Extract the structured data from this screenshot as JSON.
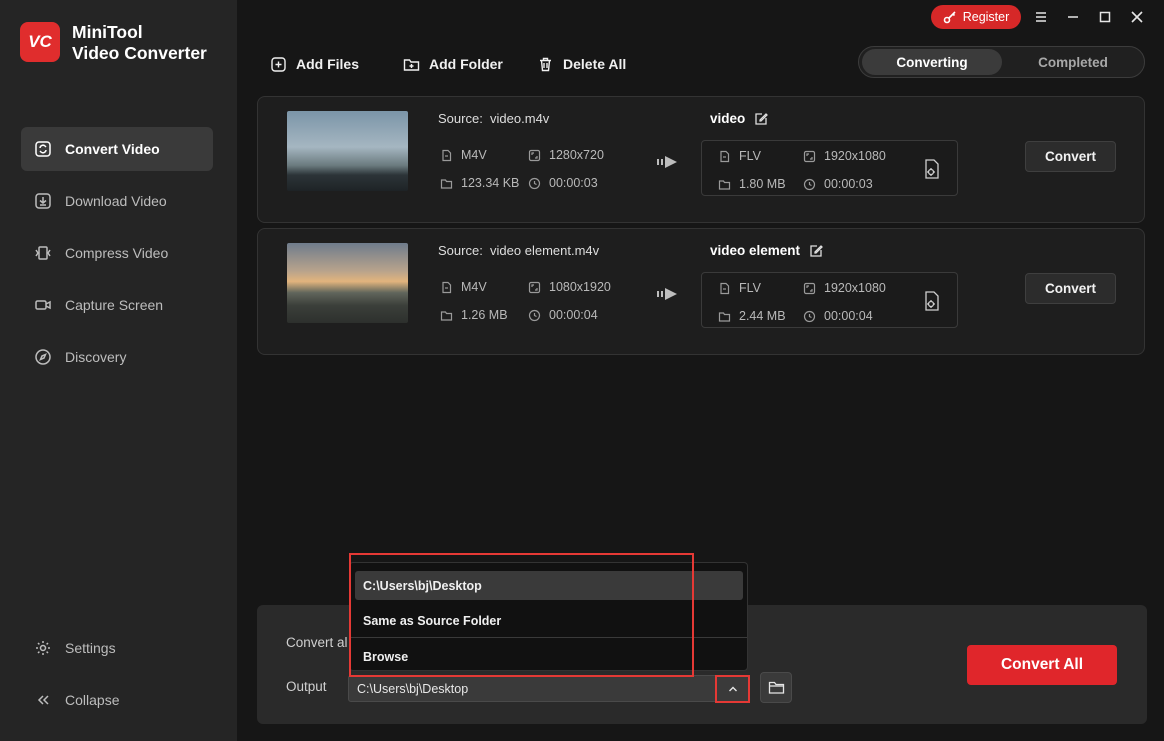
{
  "app": {
    "logo_text": "VC",
    "name_line1": "MiniTool",
    "name_line2": "Video Converter"
  },
  "sidebar": {
    "items": [
      {
        "label": "Convert Video",
        "icon": "convert-icon",
        "active": true
      },
      {
        "label": "Download Video",
        "icon": "download-icon",
        "active": false
      },
      {
        "label": "Compress Video",
        "icon": "compress-icon",
        "active": false
      },
      {
        "label": "Capture Screen",
        "icon": "camera-icon",
        "active": false
      },
      {
        "label": "Discovery",
        "icon": "compass-icon",
        "active": false
      }
    ],
    "settings_label": "Settings",
    "collapse_label": "Collapse"
  },
  "titlebar": {
    "register_label": "Register"
  },
  "toolbar": {
    "add_files": "Add Files",
    "add_folder": "Add Folder",
    "delete_all": "Delete All"
  },
  "tabs": {
    "converting": "Converting",
    "completed": "Completed"
  },
  "files": [
    {
      "source_label": "Source:",
      "source_name": "video.m4v",
      "format": "M4V",
      "resolution": "1280x720",
      "size": "123.34 KB",
      "duration": "00:00:03",
      "output_name": "video",
      "out_format": "FLV",
      "out_resolution": "1920x1080",
      "out_size": "1.80 MB",
      "out_duration": "00:00:03",
      "convert_label": "Convert"
    },
    {
      "source_label": "Source:",
      "source_name": "video element.m4v",
      "format": "M4V",
      "resolution": "1080x1920",
      "size": "1.26 MB",
      "duration": "00:00:04",
      "output_name": "video element",
      "out_format": "FLV",
      "out_resolution": "1920x1080",
      "out_size": "2.44 MB",
      "out_duration": "00:00:04",
      "convert_label": "Convert"
    }
  ],
  "bottom": {
    "convert_all_label": "Convert al",
    "output_label": "Output",
    "output_path": "C:\\Users\\bj\\Desktop",
    "convert_all_button": "Convert All"
  },
  "dropdown": {
    "options": [
      "C:\\Users\\bj\\Desktop",
      "Same as Source Folder",
      "Browse"
    ],
    "selected_index": 0
  },
  "colors": {
    "accent": "#e0262b",
    "highlight_frame": "#e53935",
    "sidebar_bg": "#252525"
  }
}
